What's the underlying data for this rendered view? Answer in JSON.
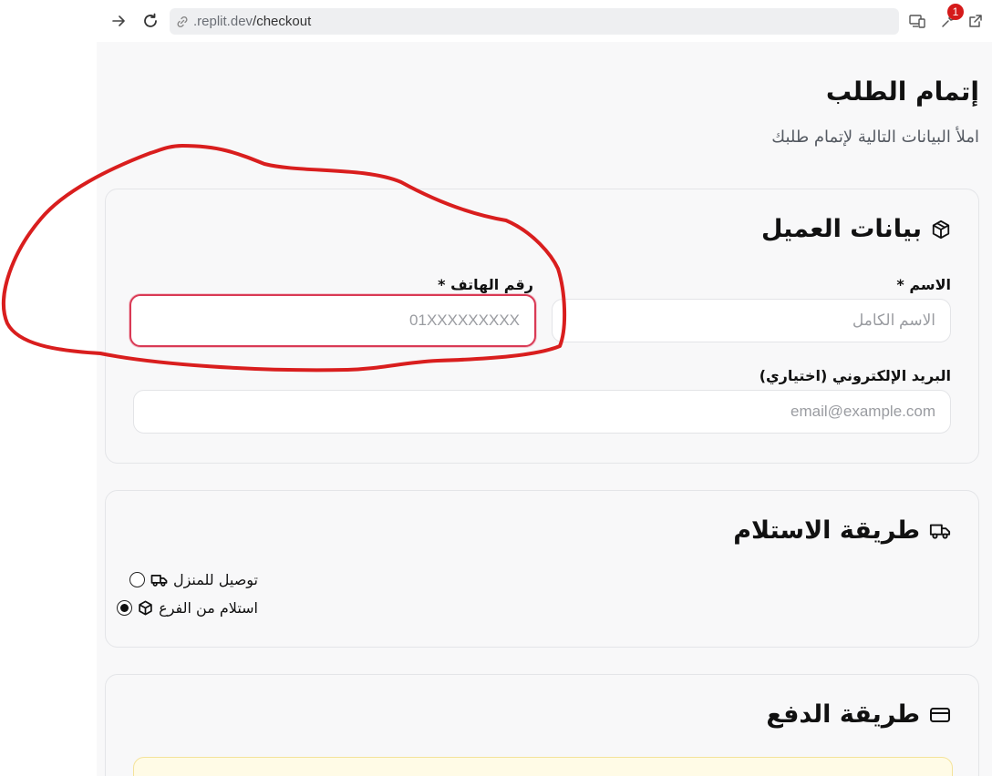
{
  "browser": {
    "url_prefix": ".replit.dev",
    "url_path": "/checkout",
    "notification_count": "1"
  },
  "page": {
    "title": "إتمام الطلب",
    "subtitle": "املأ البيانات التالية لإتمام طلبك"
  },
  "customer": {
    "title": "بيانات العميل",
    "name_label": "الاسم *",
    "name_placeholder": "الاسم الكامل",
    "phone_label": "رقم الهاتف *",
    "phone_placeholder": "01XXXXXXXXX",
    "email_label": "البريد الإلكتروني (اختياري)",
    "email_placeholder": "email@example.com"
  },
  "delivery": {
    "title": "طريقة الاستلام",
    "options": [
      {
        "label": "توصيل للمنزل",
        "icon": "truck-icon",
        "selected": false
      },
      {
        "label": "استلام من الفرع",
        "icon": "package-icon",
        "selected": true
      }
    ]
  },
  "payment": {
    "title": "طريقة الدفع"
  },
  "colors": {
    "annotation": "#d91e1e",
    "phone_border": "#d93a55",
    "badge": "#d51a1a"
  }
}
